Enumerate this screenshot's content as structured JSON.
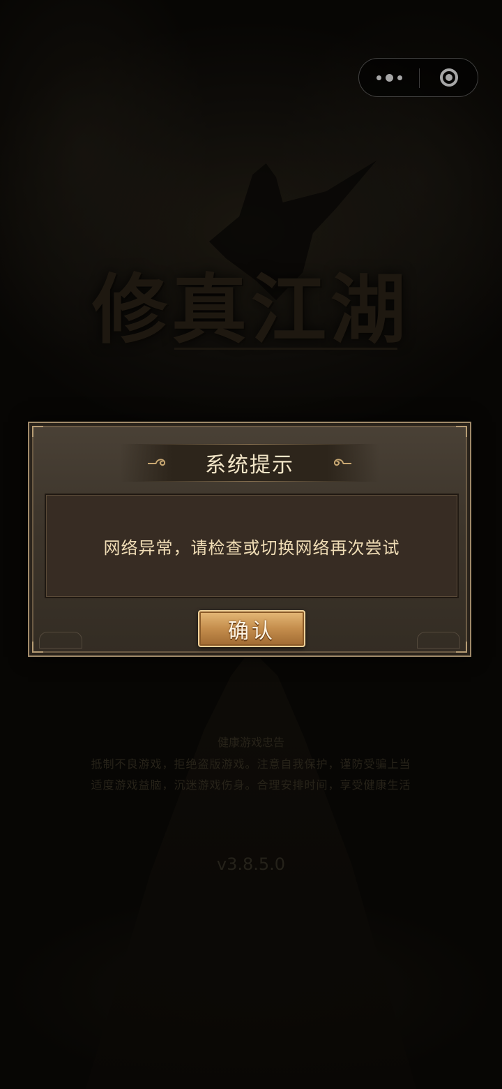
{
  "capsule": {
    "more_icon": "more-dots-icon",
    "close_icon": "target-ring-icon"
  },
  "background": {
    "game_title": "修真江湖",
    "health_notice": {
      "title": "健康游戏忠告",
      "line1": "抵制不良游戏，拒绝盗版游戏。注意自我保护，谨防受骗上当",
      "line2": "适度游戏益脑，沉迷游戏伤身。合理安排时间，享受健康生活"
    },
    "version": "v3.8.5.0"
  },
  "dialog": {
    "title": "系统提示",
    "message": "网络异常，请检查或切换网络再次尝试",
    "confirm_label": "确认"
  },
  "colors": {
    "background": "#0c0a07",
    "dialog_bg": "#3e362c",
    "message_bg": "#372c23",
    "message_text": "#efdcb5",
    "button_gold": "#c48d4c"
  }
}
